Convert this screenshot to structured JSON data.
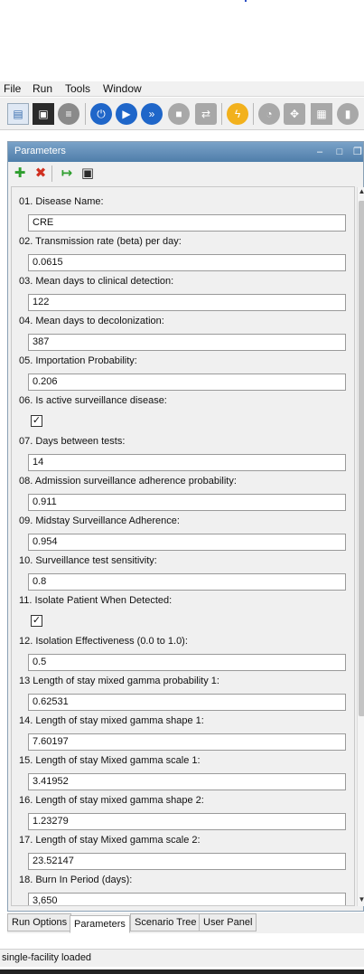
{
  "menu": [
    "File",
    "Run",
    "Tools",
    "Window"
  ],
  "toolbar": [
    {
      "icon": "open-document-icon",
      "color": "#3b6fb0"
    },
    {
      "icon": "save-disk-icon",
      "color": "#2a2a2a"
    },
    {
      "icon": "database-icon",
      "color": "#8a8a8a"
    },
    {
      "icon": "power-icon",
      "color": "#1f66c9"
    },
    {
      "icon": "play-icon",
      "color": "#1f66c9"
    },
    {
      "icon": "fast-forward-icon",
      "color": "#1f66c9"
    },
    {
      "icon": "stop-icon",
      "color": "#a8a8a8"
    },
    {
      "icon": "repeat-icon",
      "color": "#a8a8a8"
    },
    {
      "icon": "lightning-icon",
      "color": "#f2b11d"
    },
    {
      "icon": "pie-chart-icon",
      "color": "#a8a8a8"
    },
    {
      "icon": "puzzle-icon",
      "color": "#a8a8a8"
    },
    {
      "icon": "grid-table-icon",
      "color": "#a8a8a8"
    },
    {
      "icon": "trash-icon",
      "color": "#a8a8a8"
    }
  ],
  "panel": {
    "title": "Parameters",
    "tools": [
      {
        "icon": "add-plus-icon",
        "glyph": "✚",
        "color": "#2e9e2e"
      },
      {
        "icon": "delete-x-icon",
        "glyph": "✖",
        "color": "#d03020"
      },
      {
        "icon": "export-arrow-icon",
        "glyph": "↦",
        "color": "#2e9e2e"
      },
      {
        "icon": "save-disk-icon",
        "glyph": "▣",
        "color": "#2a2a2a"
      }
    ]
  },
  "params": [
    {
      "label": "01. Disease Name:",
      "type": "text",
      "value": "CRE"
    },
    {
      "label": "02. Transmission rate (beta) per day:",
      "type": "text",
      "value": "0.0615"
    },
    {
      "label": "03. Mean days to clinical detection:",
      "type": "text",
      "value": "122"
    },
    {
      "label": "04. Mean days to decolonization:",
      "type": "text",
      "value": "387"
    },
    {
      "label": "05. Importation Probability:",
      "type": "text",
      "value": "0.206"
    },
    {
      "label": "06. Is active surveillance disease:",
      "type": "check",
      "value": "✓"
    },
    {
      "label": "07. Days between tests:",
      "type": "text",
      "value": "14"
    },
    {
      "label": "08. Admission surveillance adherence probability:",
      "type": "text",
      "value": "0.911"
    },
    {
      "label": "09. Midstay Surveillance Adherence:",
      "type": "text",
      "value": "0.954"
    },
    {
      "label": "10. Surveillance test sensitivity:",
      "type": "text",
      "value": "0.8"
    },
    {
      "label": "11. Isolate Patient When Detected:",
      "type": "check",
      "value": "✓"
    },
    {
      "label": "12. Isolation Effectiveness (0.0 to 1.0):",
      "type": "text",
      "value": "0.5"
    },
    {
      "label": "13 Length of stay mixed gamma probability 1:",
      "type": "text",
      "value": "0.62531"
    },
    {
      "label": "14. Length of stay mixed gamma shape 1:",
      "type": "text",
      "value": "7.60197"
    },
    {
      "label": "15. Length of stay Mixed gamma scale 1:",
      "type": "text",
      "value": "3.41952"
    },
    {
      "label": "16. Length of stay mixed gamma shape 2:",
      "type": "text",
      "value": "1.23279"
    },
    {
      "label": "17. Length of stay Mixed gamma scale 2:",
      "type": "text",
      "value": "23.52147"
    },
    {
      "label": "18. Burn In Period (days):",
      "type": "text",
      "value": "3,650"
    }
  ],
  "tabs": [
    "Run Options",
    "Parameters",
    "Scenario Tree",
    "User Panel"
  ],
  "active_tab": "Parameters",
  "status": "single-facility loaded"
}
